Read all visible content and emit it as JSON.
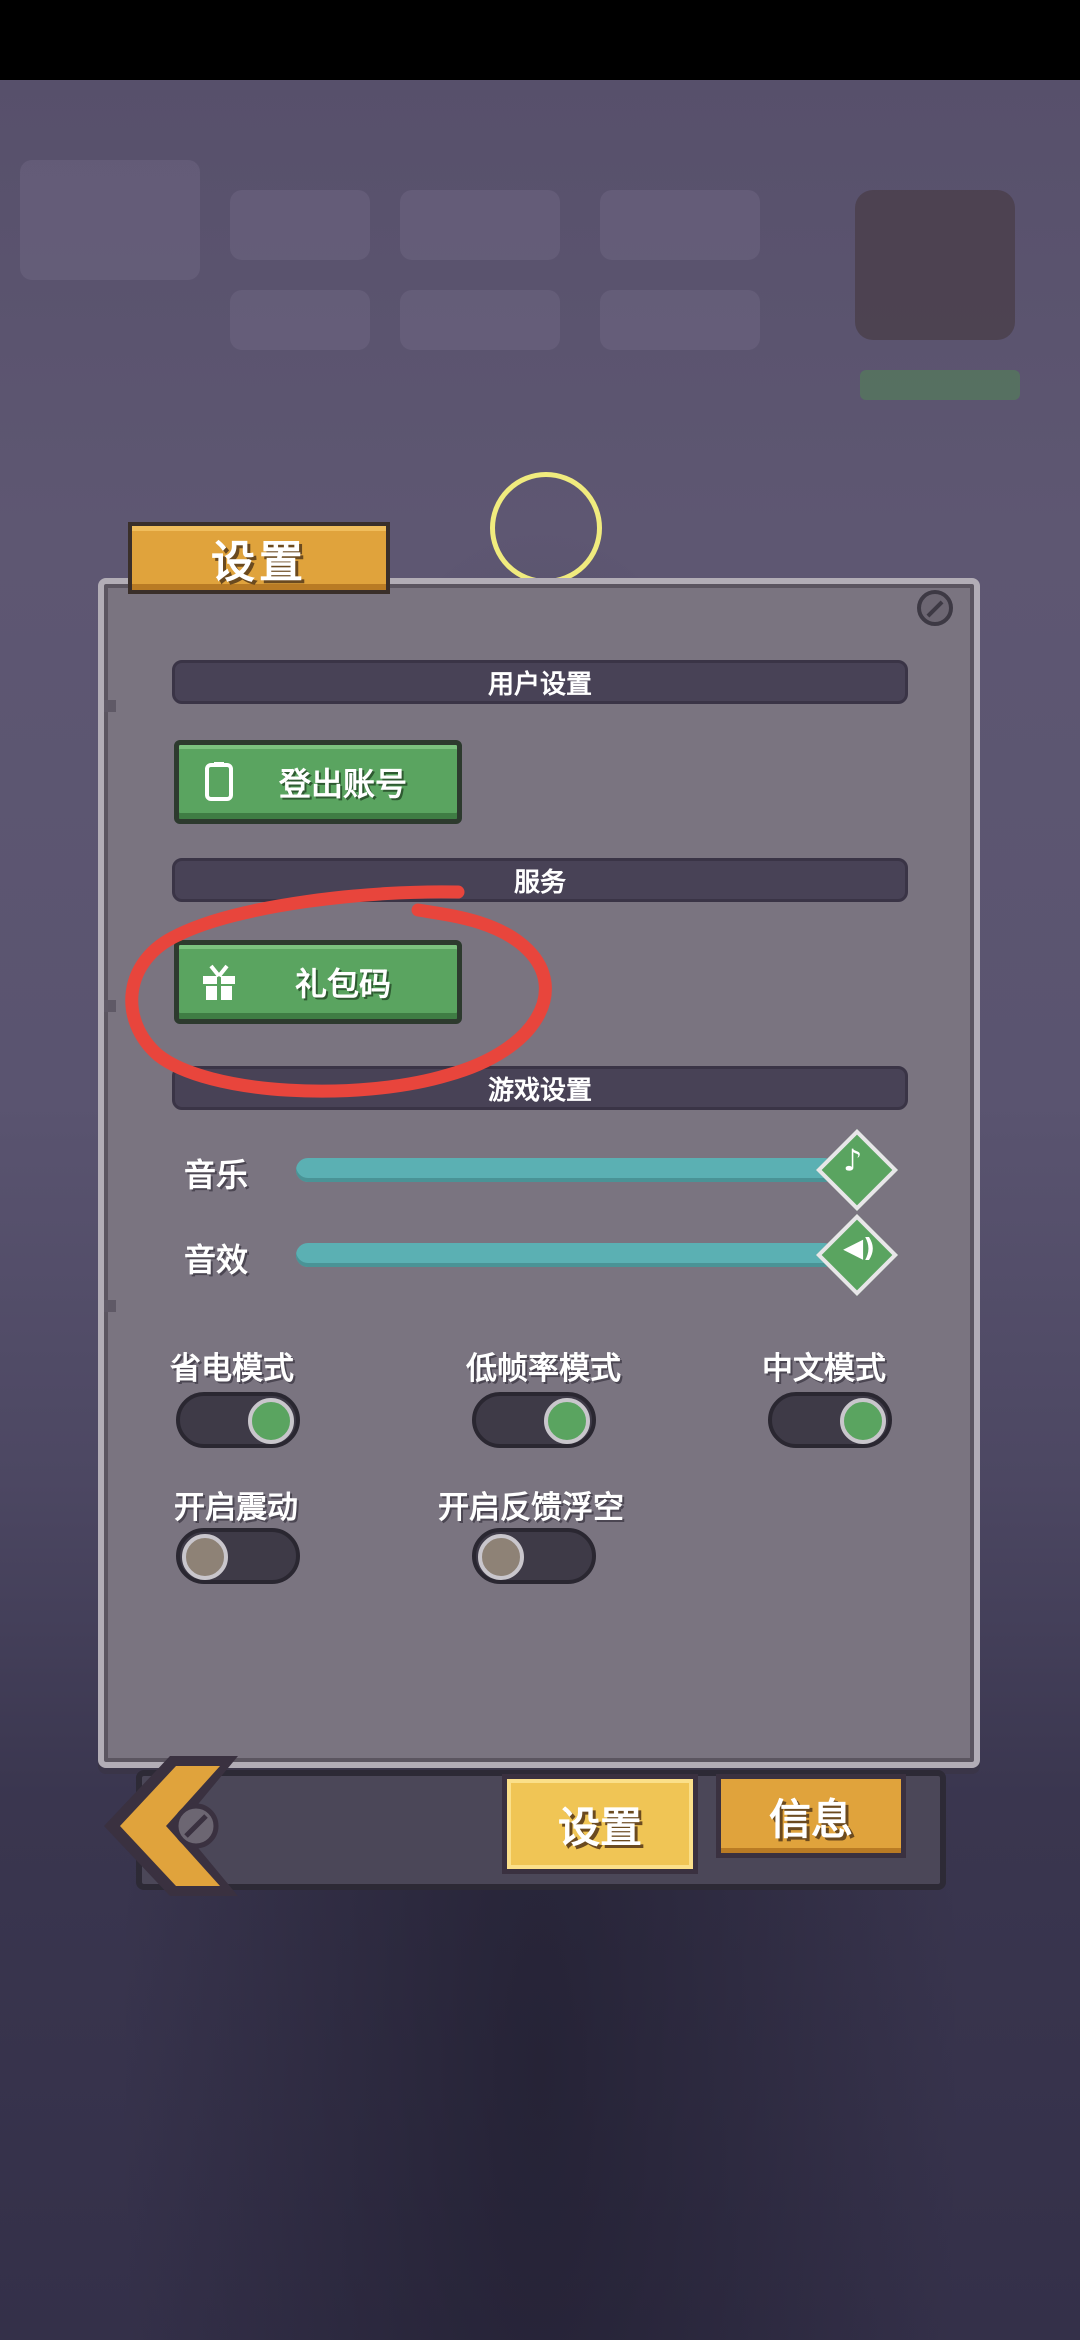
{
  "dialog": {
    "title": "设置"
  },
  "sections": {
    "user_settings": "用户设置",
    "service": "服务",
    "game_settings": "游戏设置"
  },
  "buttons": {
    "logout": "登出账号",
    "gift_code": "礼包码"
  },
  "sliders": {
    "music": {
      "label": "音乐",
      "level": 1.0,
      "icon": "music-note-icon"
    },
    "sfx": {
      "label": "音效",
      "level": 1.0,
      "icon": "speaker-icon"
    }
  },
  "toggles": {
    "power_saving": {
      "label": "省电模式",
      "on": true
    },
    "low_framerate": {
      "label": "低帧率模式",
      "on": true
    },
    "chinese": {
      "label": "中文模式",
      "on": true
    },
    "vibration": {
      "label": "开启震动",
      "on": false
    },
    "feedback_float": {
      "label": "开启反馈浮空",
      "on": false
    }
  },
  "tabs": {
    "settings": "设置",
    "info": "信息"
  },
  "colors": {
    "accent_green": "#5aa460",
    "tab_orange": "#e0a33c",
    "slider_teal": "#5bb0b3",
    "annotation_red": "#e8453c"
  }
}
